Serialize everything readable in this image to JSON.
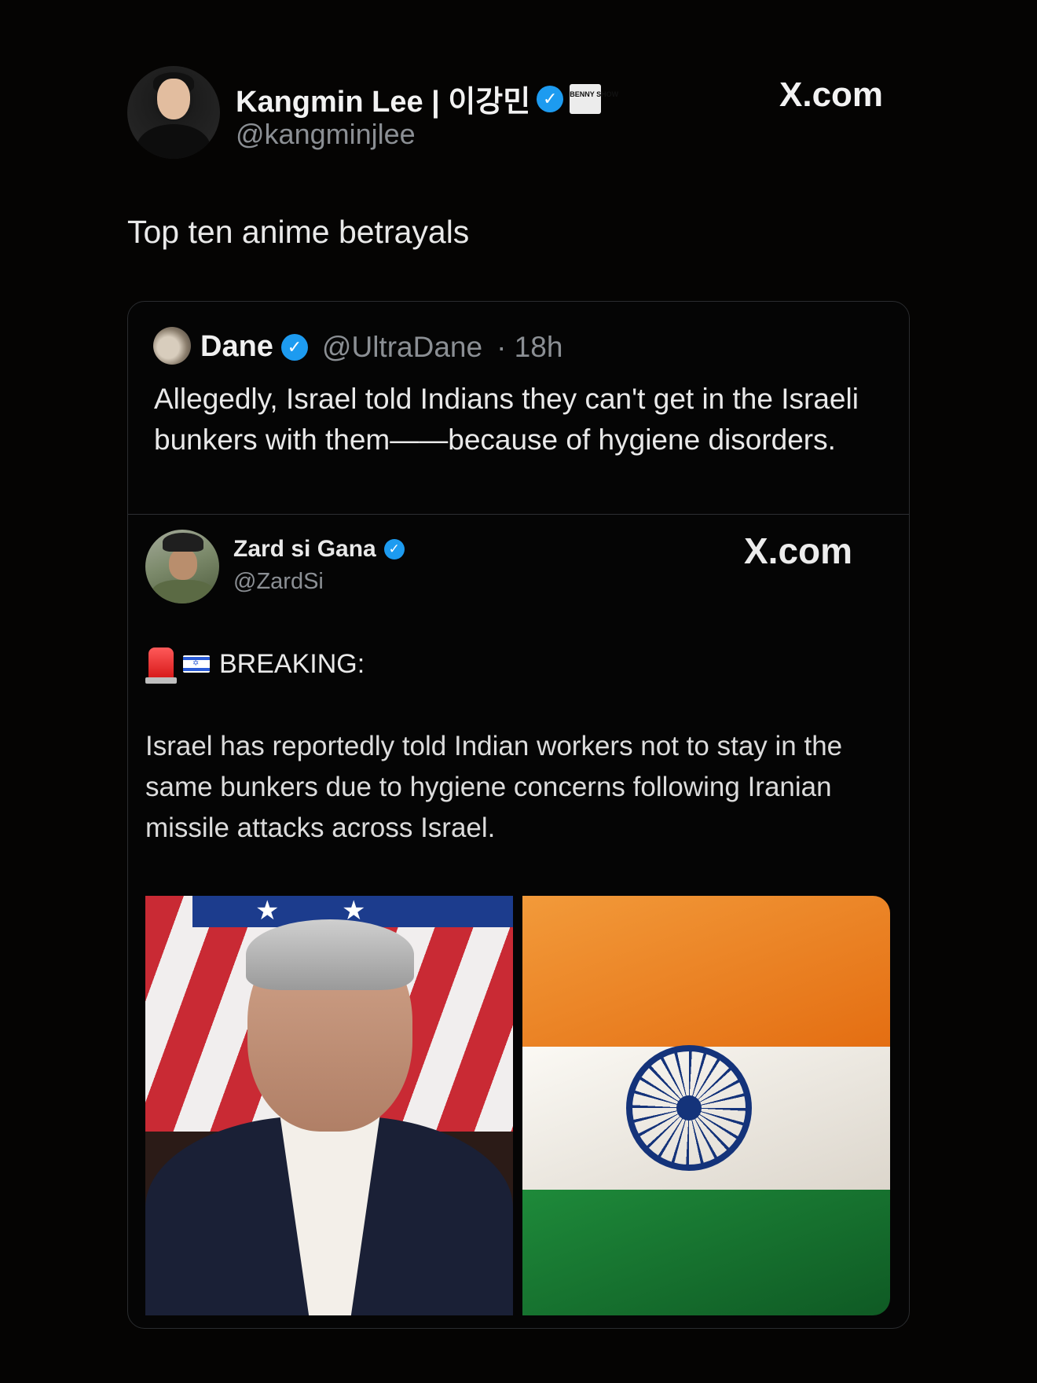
{
  "tweet": {
    "author": {
      "name": "Kangmin Lee | 이강민",
      "handle": "@kangminjlee",
      "badge_text": "BENNY SHOW"
    },
    "source": "X.com",
    "text": "Top ten anime betrayals"
  },
  "quote": {
    "author": {
      "name": "Dane",
      "handle": "@UltraDane",
      "time": "· 18h"
    },
    "text": "Allegedly, Israel told Indians they can't get in the Israeli bunkers with them——because of hygiene disorders.",
    "embedded": {
      "author": {
        "name": "Zard si Gana",
        "handle": "@ZardSi"
      },
      "source": "X.com",
      "headline": "BREAKING:",
      "body": "Israel has reportedly told Indian workers not to stay in the same bunkers due to hygiene concerns following Iranian missile attacks across Israel.",
      "icons": [
        "siren-icon",
        "israel-flag-icon"
      ],
      "images": [
        "man-in-suit-with-us-flag-photo",
        "india-flag-photo"
      ]
    }
  },
  "colors": {
    "background": "#050403",
    "verified": "#1d9bf0",
    "muted": "#8b8f94"
  }
}
